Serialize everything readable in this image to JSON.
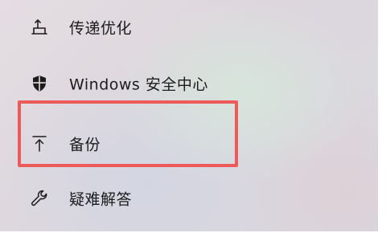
{
  "nav": {
    "items": [
      {
        "label": "传递优化",
        "icon": "delivery-optimization-icon"
      },
      {
        "label": "Windows 安全中心",
        "icon": "shield-icon"
      },
      {
        "label": "备份",
        "icon": "upload-arrow-icon"
      },
      {
        "label": "疑难解答",
        "icon": "wrench-icon"
      }
    ]
  },
  "colors": {
    "highlight_border": "#ec5a5a",
    "text": "#1c1c1c"
  }
}
